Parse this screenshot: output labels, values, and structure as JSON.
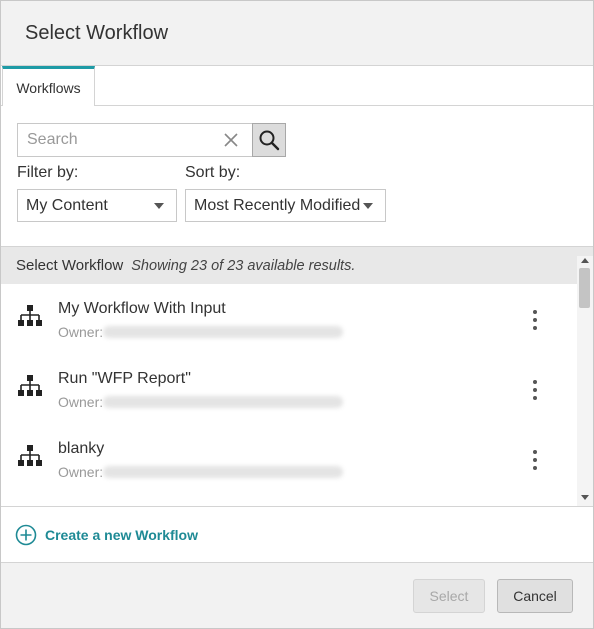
{
  "dialog": {
    "title": "Select Workflow"
  },
  "tabs": [
    {
      "label": "Workflows",
      "active": true
    }
  ],
  "search": {
    "placeholder": "Search",
    "value": ""
  },
  "filter": {
    "label": "Filter by:",
    "selected": "My Content"
  },
  "sort": {
    "label": "Sort by:",
    "selected": "Most Recently Modified"
  },
  "list": {
    "header_title": "Select Workflow",
    "results_text": "Showing 23 of 23 available results.",
    "items": [
      {
        "title": "My Workflow With Input",
        "owner_label": "Owner:"
      },
      {
        "title": "Run \"WFP Report\"",
        "owner_label": "Owner:"
      },
      {
        "title": "blanky",
        "owner_label": "Owner:"
      }
    ]
  },
  "create": {
    "label": "Create a new Workflow"
  },
  "footer": {
    "select_label": "Select",
    "cancel_label": "Cancel"
  },
  "colors": {
    "accent": "#1e9ba6",
    "link": "#1e8a95"
  }
}
